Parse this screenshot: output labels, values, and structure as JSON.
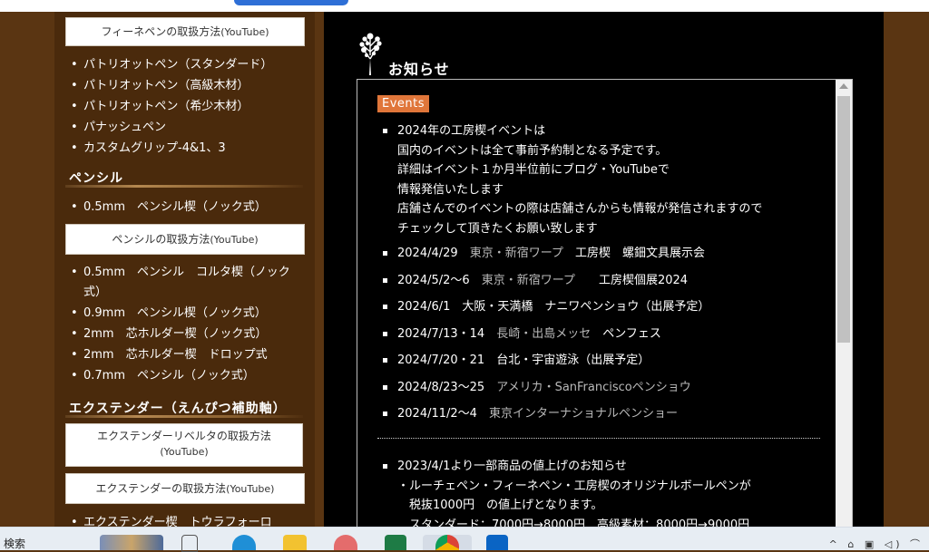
{
  "sidebar": {
    "button_fine": {
      "text": "フィーネペンの取扱方法",
      "sub": "(YouTube)"
    },
    "pen_items": [
      "パトリオットペン（スタンダード）",
      "パトリオットペン（高級木材）",
      "パトリオットペン（希少木材）",
      "パナッシュペン",
      "カスタムグリップ-4&1、3"
    ],
    "cat_pencil": "ペンシル",
    "pencil_items_a": [
      "0.5mm　ペンシル楔（ノック式）"
    ],
    "button_pencil": {
      "text": "ペンシルの取扱方法",
      "sub": "(YouTube)"
    },
    "pencil_items_b": [
      "0.5mm　ペンシル　コルタ楔（ノック式）",
      "0.9mm　ペンシル楔（ノック式）",
      "2mm　芯ホルダー楔（ノック式）",
      "2mm　芯ホルダー楔　ドロップ式",
      "0.7mm　ペンシル（ノック式）"
    ],
    "cat_extender": "エクステンダー（えんぴつ補助軸）",
    "button_extender_revelta": {
      "text": "エクステンダーリベルタの取扱方法",
      "sub": "(YouTube)"
    },
    "button_extender": {
      "text": "エクステンダーの取扱方法",
      "sub": "(YouTube)"
    },
    "extender_items": [
      "エクステンダー楔　トウラフォーロ"
    ]
  },
  "main": {
    "title": "お知らせ",
    "events_badge": "Events",
    "intro": {
      "lines": [
        "2024年の工房楔イベントは",
        "国内のイベントは全て事前予約制となる予定です。",
        "詳細はイベント１か月半位前にブログ・YouTubeで",
        "情報発信いたします",
        "店舗さんでのイベントの際は店舗さんからも情報が発信されますので",
        "チェックして頂きたくお願い致します"
      ]
    },
    "events": [
      {
        "date": "2024/4/29",
        "place": "東京・新宿ワープ",
        "name": "工房楔　螺鈿文具展示会"
      },
      {
        "date": "2024/5/2～6",
        "place": "東京・新宿ワープ　",
        "name": "工房楔個展2024"
      },
      {
        "date": "2024/6/1",
        "place": "",
        "name": "大阪・天満橋　ナニワペンショウ（出展予定）"
      },
      {
        "date": "2024/7/13・14",
        "place": "長崎・出島メッセ",
        "name": "ペンフェス"
      },
      {
        "date": "2024/7/20・21",
        "place": "",
        "name": "台北・宇宙遊泳（出展予定）"
      },
      {
        "date": "2024/8/23～25",
        "place": "アメリカ・SanFranciscoペンショウ",
        "name": ""
      },
      {
        "date": "2024/11/2～4",
        "place": "東京インターナショナルペンショー",
        "name": ""
      }
    ],
    "notice": {
      "lines": [
        "2023/4/1より一部商品の値上げのお知らせ",
        "・ルーチェペン・フィーネペン・工房楔のオリジナルボールペンが",
        "　税抜1000円　の値上げとなります。",
        "　スタンダード：7000円→8000円　高級素材：8000円→9000円"
      ]
    }
  },
  "taskbar": {
    "search_label": "検索",
    "tray_text": "^ ⌂ ▣ ◁) ⌒"
  },
  "colors": {
    "page_bg": "#5a3512",
    "sidebar_bg": "#4a2a0c",
    "main_bg": "#000000",
    "events_badge": "#e0763a"
  }
}
